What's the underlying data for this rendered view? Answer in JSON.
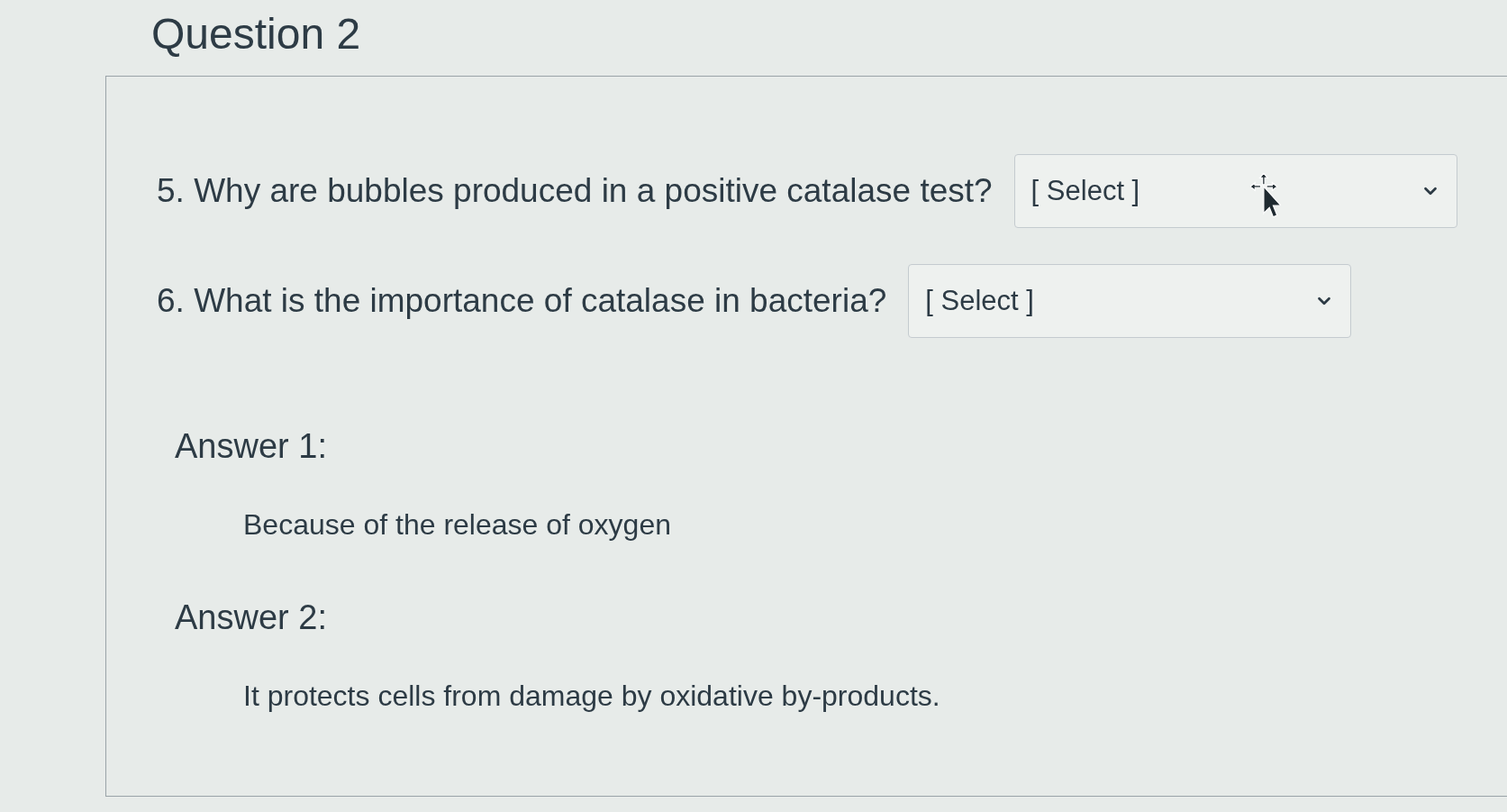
{
  "heading": "Question 2",
  "questions": [
    {
      "number": "5.",
      "text": "Why are bubbles produced in a positive catalase test?",
      "dropdown": {
        "value": "[ Select ]"
      }
    },
    {
      "number": "6.",
      "text": "What is the importance of catalase in bacteria?",
      "dropdown": {
        "value": "[ Select ]"
      }
    }
  ],
  "answers": [
    {
      "label": "Answer 1:",
      "text": "Because of the release of oxygen"
    },
    {
      "label": "Answer 2:",
      "text": "It protects cells from damage by oxidative by-products."
    }
  ]
}
